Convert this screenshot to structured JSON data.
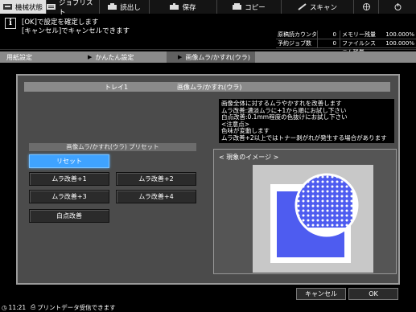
{
  "tabs": [
    {
      "label": "機械状態",
      "icon": "machine-status-icon",
      "active": true
    },
    {
      "label": "ジョブリスト",
      "icon": "job-list-icon",
      "active": false
    },
    {
      "label": "読出し",
      "icon": "recall-icon",
      "active": false
    },
    {
      "label": "保存",
      "icon": "save-icon",
      "active": false
    },
    {
      "label": "コピー",
      "icon": "copy-icon",
      "active": false
    },
    {
      "label": "スキャン",
      "icon": "scan-icon",
      "active": false
    },
    {
      "label": "",
      "icon": "globe-icon",
      "active": false
    },
    {
      "label": "",
      "icon": "power-icon",
      "active": false
    }
  ],
  "message": {
    "line1": "[OK]で設定を確定します",
    "line2": "[キャンセル]でキャンセルできます"
  },
  "counters": [
    {
      "label": "原稿読カウンター",
      "value": "0",
      "label2": "メモリー残量",
      "value2": "100.000%"
    },
    {
      "label": "予約ジョブ数",
      "value": "0",
      "label2": "ファイルシステム残量",
      "value2": "100.000%"
    }
  ],
  "breadcrumb": [
    "用紙設定",
    "かんたん設定",
    "画像ムラ/かすれ(ウラ)"
  ],
  "panel": {
    "tray": "トレイ1",
    "title": "画像ムラ/かすれ(ウラ)"
  },
  "description": [
    "画像全体に対するムラやかすれを改善します",
    "ムラ改善:濃淡ムラに+1から順にお試し下さい",
    "白点改善:0.1mm程度の色抜けにお試し下さい",
    "<注意点>",
    "色味が変動します",
    "ムラ改善+2以上ではトナー剥がれが発生する場合があります"
  ],
  "presets": {
    "title": "画像ムラ/かすれ(ウラ) プリセット",
    "reset": "リセット",
    "mura1": "ムラ改善+1",
    "mura2": "ムラ改善+2",
    "mura3": "ムラ改善+3",
    "mura4": "ムラ改善+4",
    "white": "白点改善",
    "selected": "リセット"
  },
  "image": {
    "label": "< 現象のイメージ >"
  },
  "buttons": {
    "cancel": "キャンセル",
    "ok": "OK"
  },
  "status": {
    "time": "11:21",
    "text": "プリントデータ受信できます"
  },
  "colors": {
    "accent": "#3fa3ff",
    "illustration_blue": "#4e5cf0"
  }
}
